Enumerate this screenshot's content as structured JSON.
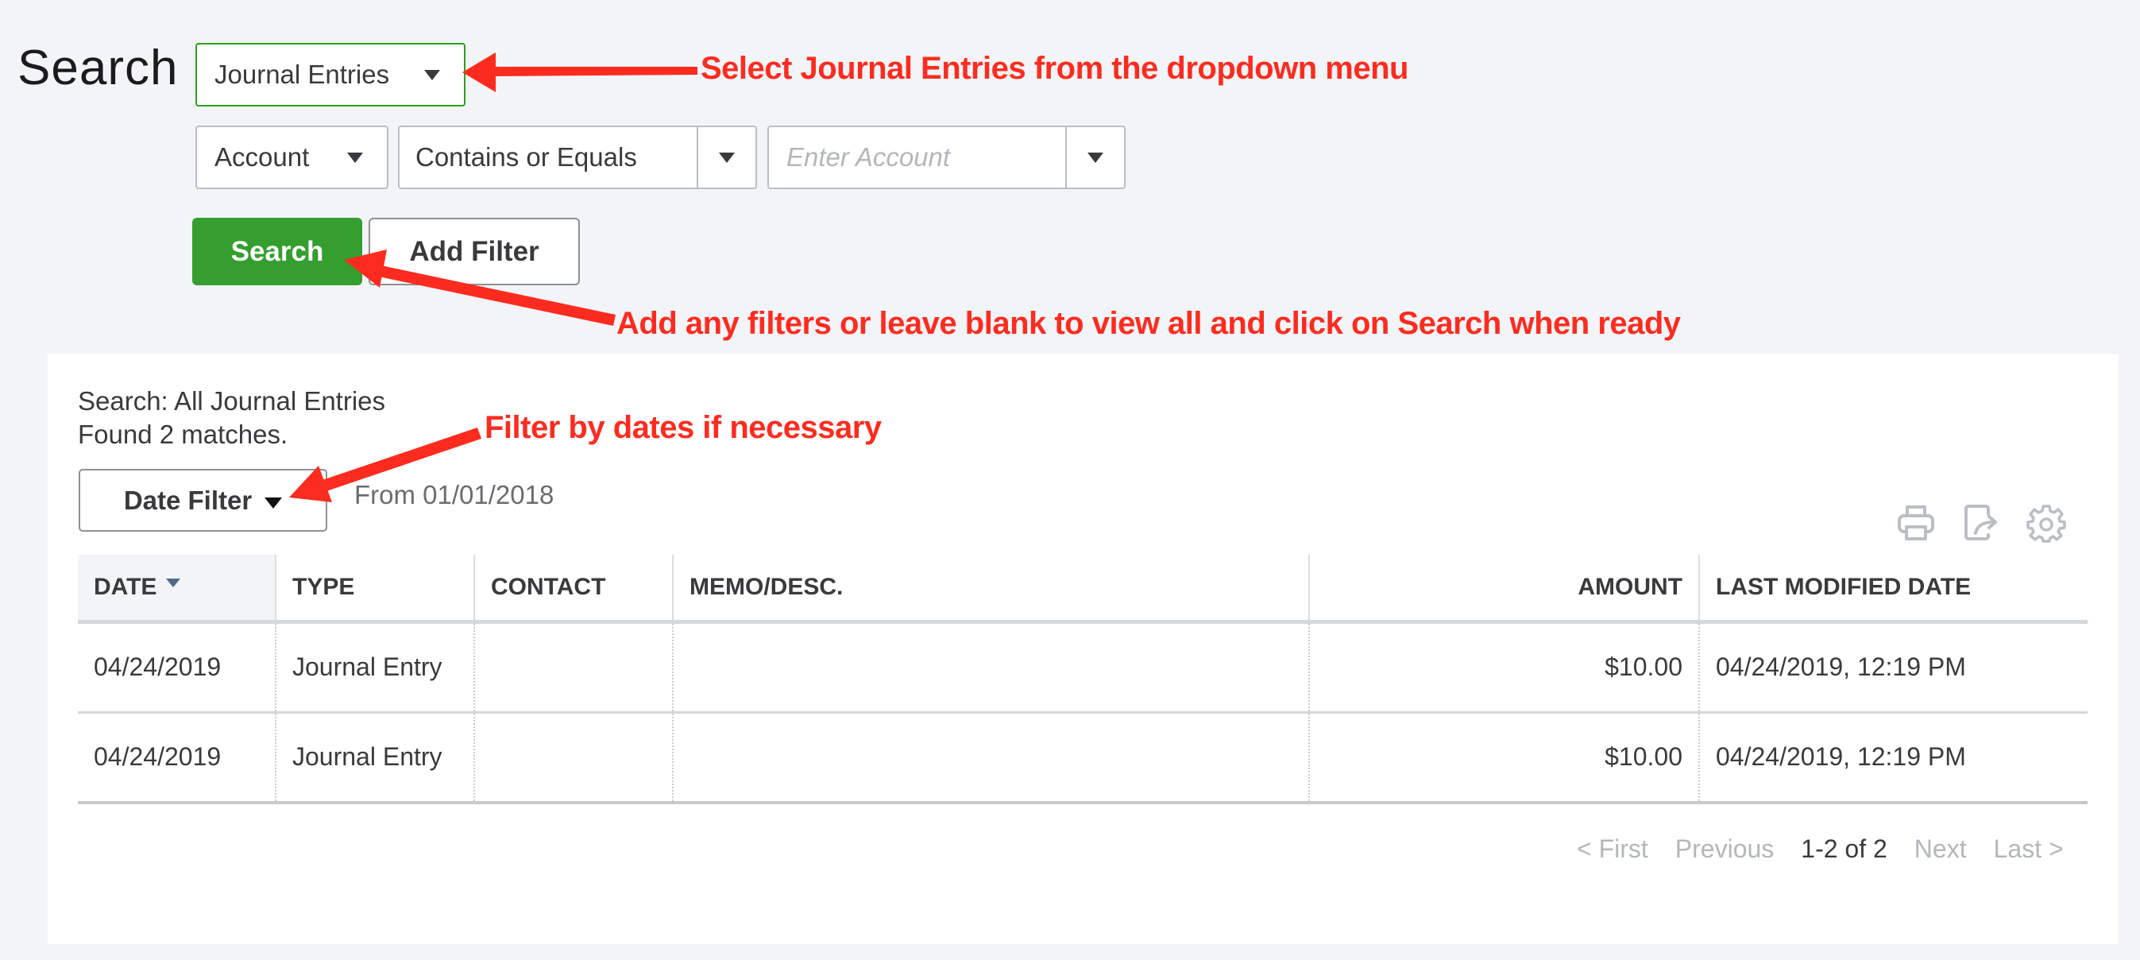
{
  "page": {
    "title": "Search"
  },
  "search_form": {
    "transaction_type": "Journal Entries",
    "filter_field": "Account",
    "filter_operator": "Contains or Equals",
    "filter_value": "",
    "filter_value_placeholder": "Enter Account",
    "search_label": "Search",
    "add_filter_label": "Add Filter"
  },
  "results": {
    "summary_line": "Search: All Journal Entries",
    "match_line": "Found 2 matches.",
    "date_filter_label": "Date Filter",
    "date_range_text": "From 01/01/2018",
    "toolbar_icons": [
      "printer-icon",
      "export-icon",
      "gear-icon"
    ],
    "columns": [
      {
        "key": "date",
        "label": "DATE",
        "sorted": "desc"
      },
      {
        "key": "type",
        "label": "TYPE"
      },
      {
        "key": "contact",
        "label": "CONTACT"
      },
      {
        "key": "memo",
        "label": "MEMO/DESC."
      },
      {
        "key": "amount",
        "label": "AMOUNT"
      },
      {
        "key": "modified",
        "label": "LAST MODIFIED DATE"
      }
    ],
    "rows": [
      {
        "date": "04/24/2019",
        "type": "Journal Entry",
        "contact": "",
        "memo": "",
        "amount": "$10.00",
        "modified": "04/24/2019, 12:19 PM"
      },
      {
        "date": "04/24/2019",
        "type": "Journal Entry",
        "contact": "",
        "memo": "",
        "amount": "$10.00",
        "modified": "04/24/2019, 12:19 PM"
      }
    ],
    "pagination": {
      "first": "< First",
      "previous": "Previous",
      "range": "1-2 of 2",
      "next": "Next",
      "last": "Last >"
    }
  },
  "annotations": {
    "note_1": "Select Journal Entries from the dropdown menu",
    "note_2": "Add any filters or leave blank to view all and click on Search when ready",
    "note_3": "Filter by dates if necessary",
    "color": "#fb2c1f"
  },
  "colors": {
    "accent_green": "#349e2e",
    "background": "#f3f4f8"
  }
}
